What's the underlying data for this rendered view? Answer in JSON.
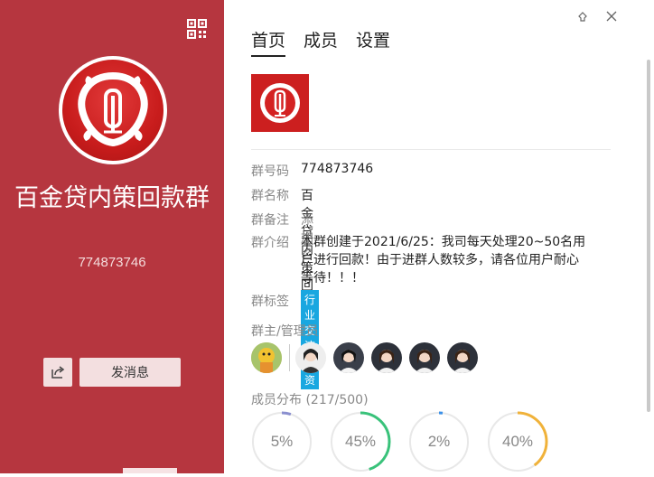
{
  "left_panel": {
    "group_name": "百金贷内策回款群",
    "group_id": "774873746",
    "send_message_label": "发消息"
  },
  "tabs": [
    {
      "label": "首页",
      "active": true
    },
    {
      "label": "成员",
      "active": false
    },
    {
      "label": "设置",
      "active": false
    }
  ],
  "info": {
    "group_number_label": "群号码",
    "group_number_value": "774873746",
    "group_name_label": "群名称",
    "group_name_value": "百金贷内策回款群",
    "group_remark_label": "群备注",
    "group_remark_value": "添加",
    "group_intro_label": "群介绍",
    "group_intro_value": "本群创建于2021/6/25：我司每天处理20~50名用户进行回款！由于进群人数较多，请各位用户耐心等待！！！",
    "group_tags_label": "群标签",
    "tags": [
      "行业交流",
      "投资"
    ]
  },
  "admins_label": "群主/管理员",
  "member_dist_label": "成员分布 (217/500)",
  "distribution": [
    {
      "pct_label": "5%",
      "value": 0.05,
      "color": "#8a8fcf"
    },
    {
      "pct_label": "45%",
      "value": 0.45,
      "color": "#39c27a"
    },
    {
      "pct_label": "2%",
      "value": 0.02,
      "color": "#3a90e8"
    },
    {
      "pct_label": "40%",
      "value": 0.4,
      "color": "#f0b23a"
    }
  ],
  "colors": {
    "left_bg": "#b6363f",
    "tag_bg": "#19a7e0"
  }
}
